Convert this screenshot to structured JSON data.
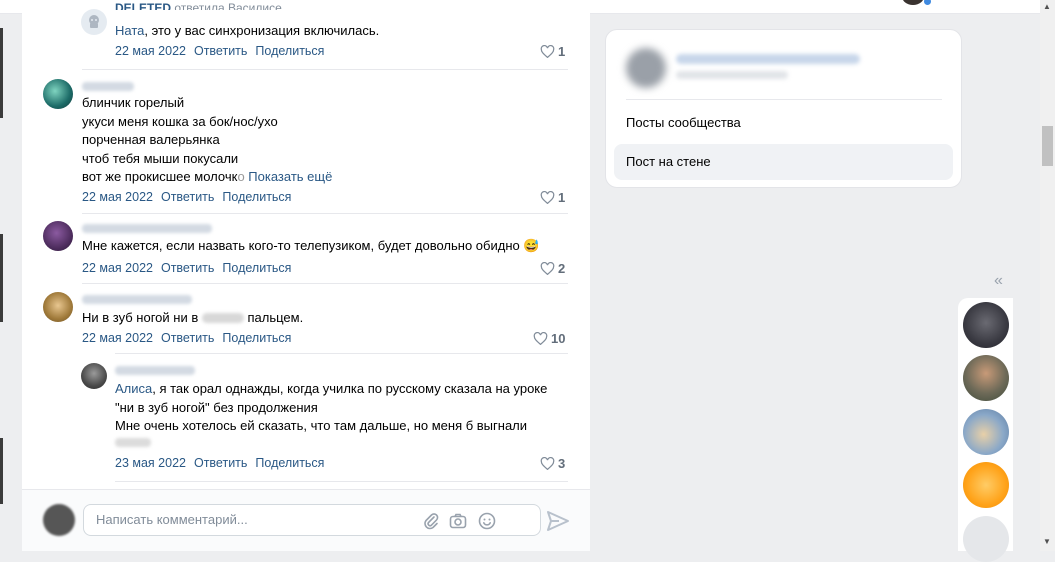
{
  "comments": [
    {
      "author_label": "DELETED",
      "author_reply_to": "ответила Василисе",
      "reply_to": "Ната",
      "text": ", это у вас синхронизация включилась.",
      "date": "22 мая 2022",
      "reply_label": "Ответить",
      "share_label": "Поделиться",
      "likes": "1"
    },
    {
      "lines": [
        "блинчик горелый",
        "укуси меня кошка за бок/нос/ухо",
        "порченная валерьянка",
        "чтоб тебя мыши покусали"
      ],
      "last_line": "вот же прокисшее молочк",
      "last_line_fade": "о",
      "show_more": "Показать ещё",
      "date": "22 мая 2022",
      "reply_label": "Ответить",
      "share_label": "Поделиться",
      "likes": "1"
    },
    {
      "text": "Мне кажется, если назвать кого-то телепузиком, будет довольно обидно",
      "emoji": "😅",
      "date": "22 мая 2022",
      "reply_label": "Ответить",
      "share_label": "Поделиться",
      "likes": "2"
    },
    {
      "text_before": "Ни в зуб ногой ни в",
      "text_after": "пальцем.",
      "date": "22 мая 2022",
      "reply_label": "Ответить",
      "share_label": "Поделиться",
      "likes": "10"
    },
    {
      "reply_to": "Алиса",
      "line1": ", я так орал однажды, когда училка по русскому сказала на уроке",
      "line2": "\"ни в зуб ногой\" без продолжения",
      "line3": "Мне очень хотелось ей сказать, что там дальше, но меня б выгнали",
      "date": "23 мая 2022",
      "reply_label": "Ответить",
      "share_label": "Поделиться",
      "likes": "3"
    }
  ],
  "composer": {
    "placeholder": "Написать комментарий..."
  },
  "sidebar": {
    "items": [
      {
        "label": "Посты сообщества"
      },
      {
        "label": "Пост на стене"
      }
    ]
  },
  "colors": {
    "link": "#2a5885",
    "accent": "#3f8ae0",
    "selected_bg": "#f0f2f5"
  },
  "icons": [
    "attach-icon",
    "camera-icon",
    "emoji-icon",
    "send-icon",
    "heart-icon",
    "collapse-icon"
  ]
}
